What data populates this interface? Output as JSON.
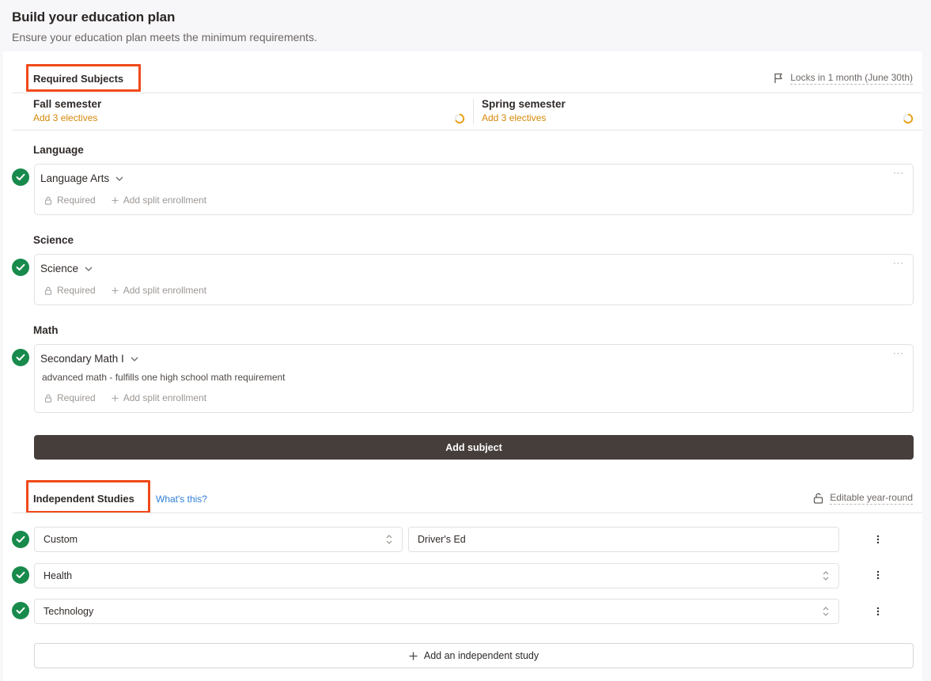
{
  "header": {
    "title": "Build your education plan",
    "subtitle": "Ensure your education plan meets the minimum requirements."
  },
  "required": {
    "title": "Required Subjects",
    "lock_note": "Locks in 1 month (June 30th)",
    "semesters": [
      {
        "title": "Fall semester",
        "note": "Add 3 electives"
      },
      {
        "title": "Spring semester",
        "note": "Add 3 electives"
      }
    ],
    "groups": [
      {
        "label": "Language",
        "subject": "Language Arts",
        "description": "",
        "required": "Required",
        "split": "Add split enrollment"
      },
      {
        "label": "Science",
        "subject": "Science",
        "description": "",
        "required": "Required",
        "split": "Add split enrollment"
      },
      {
        "label": "Math",
        "subject": "Secondary Math I",
        "description": "advanced math - fulfills one high school math requirement",
        "required": "Required",
        "split": "Add split enrollment"
      }
    ],
    "add_subject_label": "Add subject"
  },
  "independent": {
    "title": "Independent Studies",
    "help_link": "What's this?",
    "edit_note": "Editable year-round",
    "rows": [
      {
        "category": "Custom",
        "custom_value": "Driver's Ed"
      },
      {
        "category": "Health"
      },
      {
        "category": "Technology"
      }
    ],
    "add_label": "Add an independent study"
  },
  "colors": {
    "accent_highlight": "#f04a1a",
    "success": "#188a4c",
    "warning": "#d4890a",
    "primary_button": "#463e3b",
    "link": "#2f7fd6"
  }
}
